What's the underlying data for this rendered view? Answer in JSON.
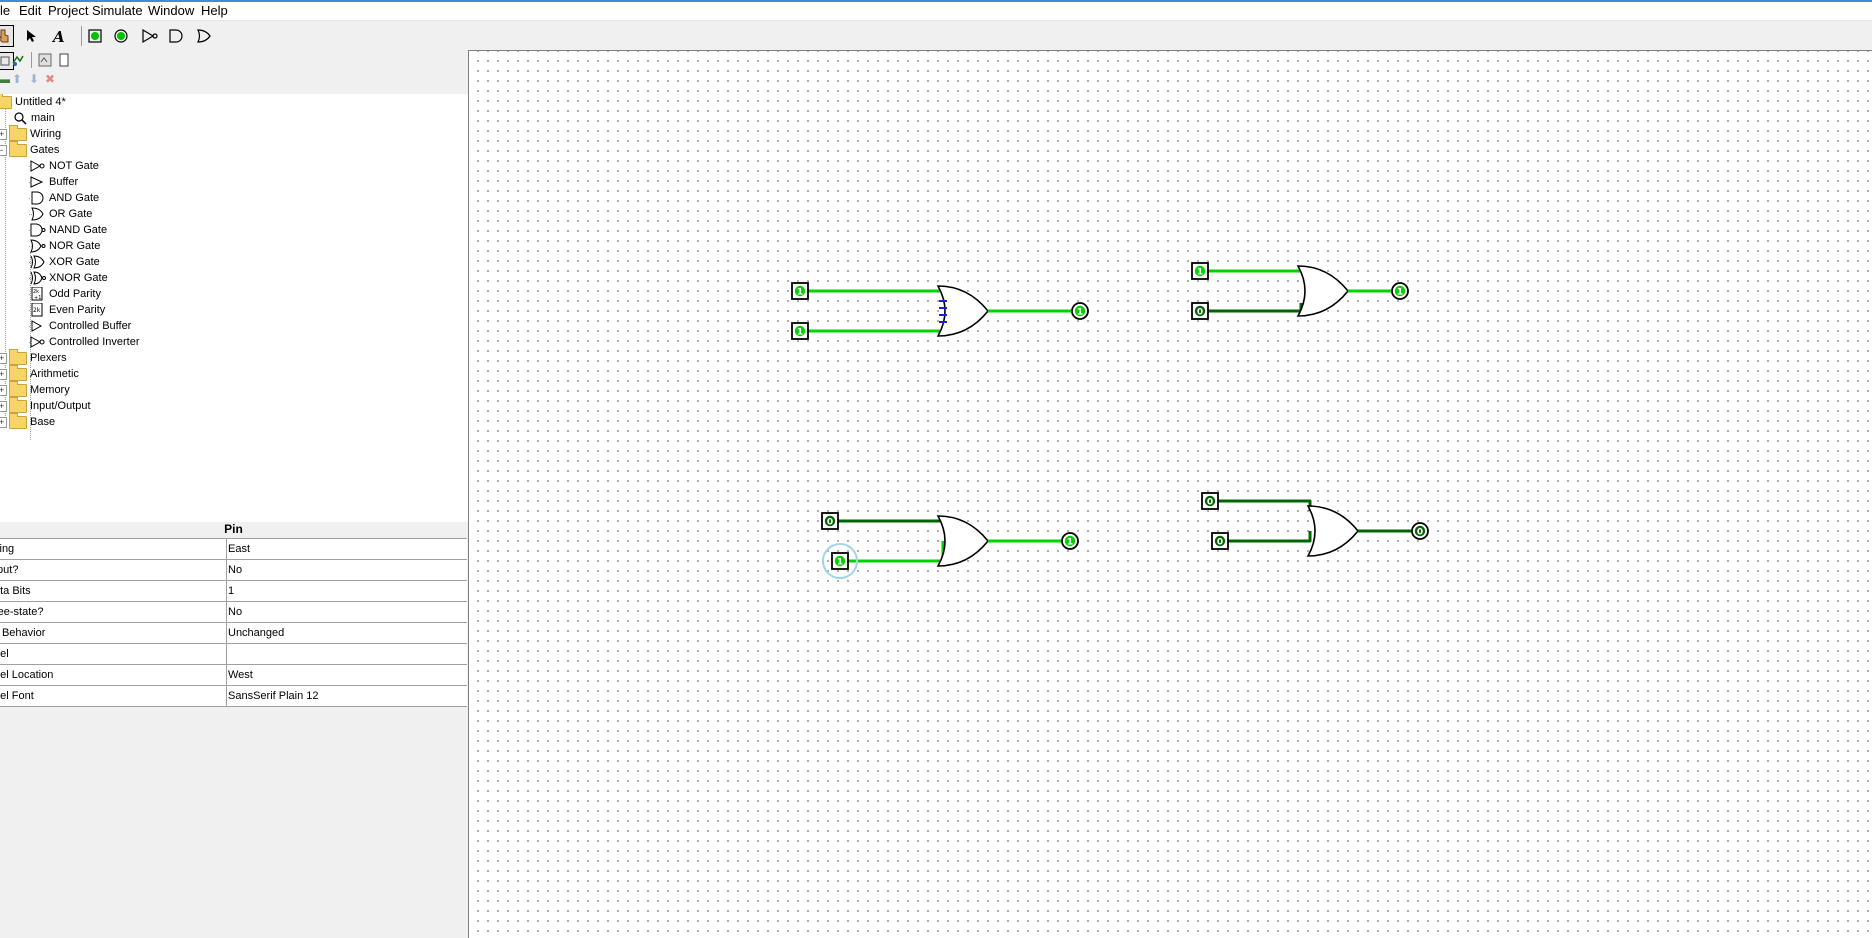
{
  "menu": {
    "file": "le",
    "edit": "Edit",
    "project": "Project",
    "simulate": "Simulate",
    "window": "Window",
    "help": "Help"
  },
  "toolbar": {
    "tools": [
      "poke-tool",
      "select-tool",
      "text-tool",
      "input-pin",
      "output-pin",
      "not-gate",
      "and-gate",
      "or-gate"
    ]
  },
  "tree": {
    "project": "Untitled 4*",
    "circuit": "main",
    "folders": {
      "wiring": "Wiring",
      "gates": "Gates",
      "plexers": "Plexers",
      "arithmetic": "Arithmetic",
      "memory": "Memory",
      "io": "Input/Output",
      "base": "Base"
    },
    "gates": [
      "NOT Gate",
      "Buffer",
      "AND Gate",
      "OR Gate",
      "NAND Gate",
      "NOR Gate",
      "XOR Gate",
      "XNOR Gate",
      "Odd Parity",
      "Even Parity",
      "Controlled Buffer",
      "Controlled Inverter"
    ]
  },
  "attributes": {
    "title": "Pin",
    "rows": [
      {
        "key": "cing",
        "value": "East"
      },
      {
        "key": "tput?",
        "value": "No"
      },
      {
        "key": "ata Bits",
        "value": "1"
      },
      {
        "key": "ree-state?",
        "value": "No"
      },
      {
        "key": "ll Behavior",
        "value": "Unchanged"
      },
      {
        "key": "bel",
        "value": ""
      },
      {
        "key": "bel Location",
        "value": "West"
      },
      {
        "key": "bel Font",
        "value": "SansSerif Plain 12"
      }
    ]
  },
  "circuit": {
    "colors": {
      "high": "#00d200",
      "low": "#006400",
      "wire_bus": "#1c1cd9"
    },
    "circuits": [
      {
        "in_a": "1",
        "in_b": "1",
        "out": "1"
      },
      {
        "in_a": "1",
        "in_b": "0",
        "out": "1"
      },
      {
        "in_a": "0",
        "in_b": "1",
        "out": "1"
      },
      {
        "in_a": "0",
        "in_b": "0",
        "out": "0"
      }
    ]
  }
}
